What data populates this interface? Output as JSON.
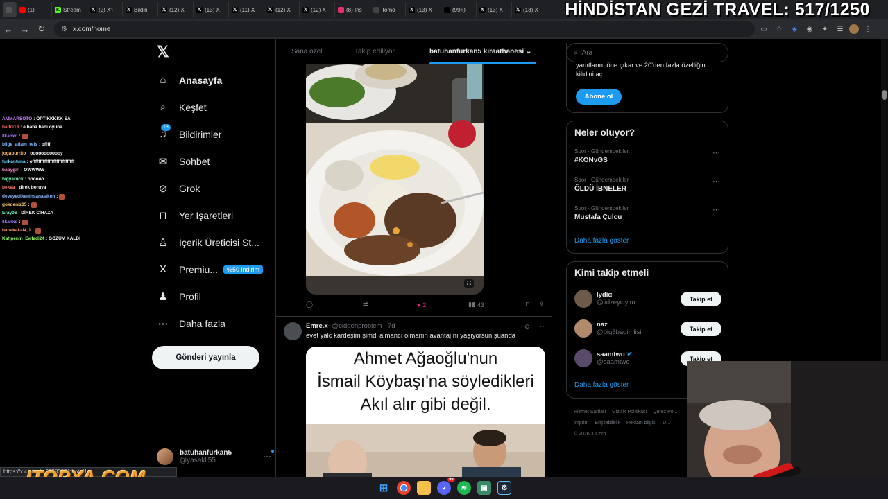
{
  "tabs": [
    {
      "label": "",
      "icon": "chrome-menu-icon"
    },
    {
      "label": "(1)",
      "icon": "youtube-icon",
      "color": "#ff0000"
    },
    {
      "label": "Stream",
      "icon": "kick-icon",
      "color": "#53fc18"
    },
    {
      "label": "(2) X'i",
      "icon": "x-icon",
      "color": "#000000"
    },
    {
      "label": "Bildiri",
      "icon": "x-icon",
      "color": "#000000"
    },
    {
      "label": "(12) X",
      "icon": "x-icon",
      "color": "#000000"
    },
    {
      "label": "(13) X",
      "icon": "x-icon",
      "color": "#000000"
    },
    {
      "label": "(11) X",
      "icon": "x-icon",
      "color": "#000000"
    },
    {
      "label": "(12) X",
      "icon": "x-icon",
      "color": "#000000"
    },
    {
      "label": "(12) X",
      "icon": "x-icon",
      "color": "#000000"
    },
    {
      "label": "(8) Ins",
      "icon": "instagram-icon",
      "color": "#e1306c"
    },
    {
      "label": "Tomo",
      "icon": "tomo-icon",
      "color": "#444444"
    },
    {
      "label": "(13) X",
      "icon": "x-icon",
      "color": "#000000"
    },
    {
      "label": "(99+)",
      "icon": "tiktok-icon",
      "color": "#000000"
    },
    {
      "label": "(13) X",
      "icon": "x-icon",
      "color": "#000000"
    },
    {
      "label": "(13) X",
      "icon": "x-icon",
      "color": "#000000"
    }
  ],
  "banner": "HİNDİSTAN GEZİ TRAVEL: 517/1250",
  "url": "x.com/home",
  "chat": [
    {
      "user": "AMMARSOTO",
      "color": "#c98bff",
      "msg": ": OPTİKKKKK SA"
    },
    {
      "user": "baltci13",
      "color": "#ff6b6b",
      "msg": ": e baba hadi oyuna"
    },
    {
      "user": "ilkanxd",
      "color": "#a57bff",
      "msg": ":",
      "emote": true
    },
    {
      "user": "bilge_adam_reis",
      "color": "#7ab8ff",
      "msg": ": offff"
    },
    {
      "user": "jogaburrito",
      "color": "#ffb36b",
      "msg": ": oooooooooooy"
    },
    {
      "user": "furkantuna",
      "color": "#6bd4ff",
      "msg": ": offffffffffffffffffffffffffff"
    },
    {
      "user": "babygirl",
      "color": "#ff8bd4",
      "msg": ": OWWWW"
    },
    {
      "user": "bigyarock",
      "color": "#7affb8",
      "msg": ": oooooo"
    },
    {
      "user": "bekea",
      "color": "#ff7a7a",
      "msg": ": direk boruya"
    },
    {
      "user": "deveyedikeninsanasiken",
      "color": "#8bb8ff",
      "msg": ":",
      "emote": true
    },
    {
      "user": "gokdeniz35",
      "color": "#ffcf6b",
      "msg": ":",
      "emote": true
    },
    {
      "user": "Eray06",
      "color": "#6bffd4",
      "msg": ": DİREK CİHAZA"
    },
    {
      "user": "ilkanxd",
      "color": "#a57bff",
      "msg": ":",
      "emote": true
    },
    {
      "user": "babakakaN_1",
      "color": "#ff9a6b",
      "msg": ":",
      "emote": true
    },
    {
      "user": "Kahpenin_Ewladi24",
      "color": "#9bff6b",
      "msg": ": GÖZÜM KALDI"
    }
  ],
  "nav": [
    {
      "label": "Anasayfa",
      "icon": "home-icon",
      "glyph": "⌂",
      "active": true
    },
    {
      "label": "Keşfet",
      "icon": "search-icon",
      "glyph": "⌕"
    },
    {
      "label": "Bildirimler",
      "icon": "bell-icon",
      "glyph": "♫",
      "badge": "13"
    },
    {
      "label": "Sohbet",
      "icon": "mail-icon",
      "glyph": "✉"
    },
    {
      "label": "Grok",
      "icon": "grok-icon",
      "glyph": "⊘"
    },
    {
      "label": "Yer İşaretleri",
      "icon": "bookmark-icon",
      "glyph": "⊓"
    },
    {
      "label": "İçerik Üreticisi St...",
      "icon": "creator-icon",
      "glyph": "♙"
    },
    {
      "label": "Premiu...",
      "icon": "x-premium-icon",
      "glyph": "X",
      "promo": "%50 indirim"
    },
    {
      "label": "Profil",
      "icon": "profile-icon",
      "glyph": "♟"
    },
    {
      "label": "Daha fazla",
      "icon": "more-icon",
      "glyph": "⋯"
    }
  ],
  "post_button": "Gönderi yayınla",
  "account": {
    "name": "batuhanfurkan5",
    "handle": "@yasakli55"
  },
  "timeline_tabs": [
    "Sana özel",
    "Takip ediliyor",
    "batuhanfurkan5 kıraathanesi"
  ],
  "tweet1_actions": {
    "reply": "",
    "retweet": "",
    "likes": "2",
    "views": "43"
  },
  "tweet2": {
    "name": "Emre.x-",
    "handle": "@ciddenproblem",
    "time": "· 7d",
    "text": "evet yalc kardeşim şimdi almancı olmanın avantajını yaşıyorsun şuanda",
    "meme": [
      "Ahmet Ağaoğlu'nun",
      "İsmail Köybaşı'na söyledikleri",
      "Akıl alır gibi değil."
    ]
  },
  "search_placeholder": "Ara",
  "premium_panel": {
    "text": "yanıtlarını öne çıkar ve 20'den fazla özelliğin kilidini aç.",
    "button": "Abone ol"
  },
  "trends": {
    "title": "Neler oluyor?",
    "items": [
      {
        "category": "Spor · Gündemdekiler",
        "name": "#KONvGS"
      },
      {
        "category": "Spor · Gündemdekiler",
        "name": "ÖLDÜ İBNELER"
      },
      {
        "category": "Spor · Gündemdekiler",
        "name": "Mustafa Çulcu"
      }
    ],
    "more": "Daha fazla göster"
  },
  "who_to_follow": {
    "title": "Kimi takip etmeli",
    "items": [
      {
        "name": "lydiα",
        "handle": "@lidzeyclyim",
        "button": "Takip et",
        "color": "#6e5a4a"
      },
      {
        "name": "naz",
        "handle": "@big5bagimlisi",
        "button": "Takip et",
        "color": "#b08a6a"
      },
      {
        "name": "saamtwo",
        "handle": "@saamtwo",
        "button": "Takip et",
        "verified": true,
        "color": "#5a4a6a"
      }
    ],
    "more": "Daha fazla göster"
  },
  "footer": [
    "Hizmet Şartları",
    "Gizlilik Politikası",
    "Çerez Po...",
    "İmprint",
    "Erişilebilirlik",
    "Reklam bilgisi",
    "D...",
    "© 2026 X Corp."
  ],
  "status_url": "https://x.c...tus/...2198305/photo/1",
  "watermark": "ITOPYA.COM",
  "taskbar_badge": "9+"
}
